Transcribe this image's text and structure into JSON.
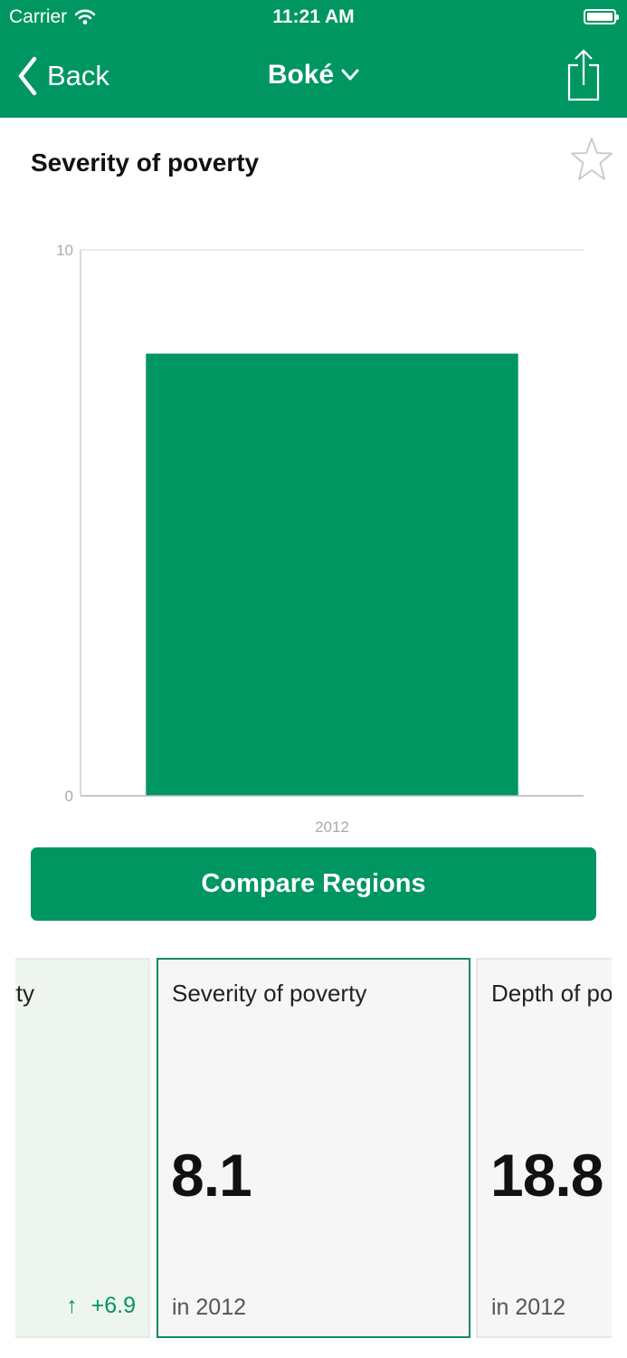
{
  "status_bar": {
    "carrier": "Carrier",
    "time": "11:21 AM"
  },
  "nav": {
    "back_label": "Back",
    "title": "Boké"
  },
  "indicator": {
    "title": "Severity of poverty"
  },
  "chart_data": {
    "type": "bar",
    "categories": [
      "2012"
    ],
    "values": [
      8.1
    ],
    "ylim": [
      0,
      10
    ],
    "yticks": [
      "0",
      "10"
    ],
    "title": "",
    "xlabel": "",
    "ylabel": "",
    "colors": {
      "bar": "#009661"
    }
  },
  "compare_button": {
    "label": "Compare Regions"
  },
  "cards": [
    {
      "title": "Incidence of poverty",
      "value": "",
      "year": "",
      "change": "+6.9"
    },
    {
      "title": "Severity of poverty",
      "value": "8.1",
      "year": "in 2012"
    },
    {
      "title": "Depth of poverty",
      "value": "18.8",
      "year": "in 2012"
    }
  ],
  "colors": {
    "brand": "#009661",
    "text": "#111111"
  }
}
